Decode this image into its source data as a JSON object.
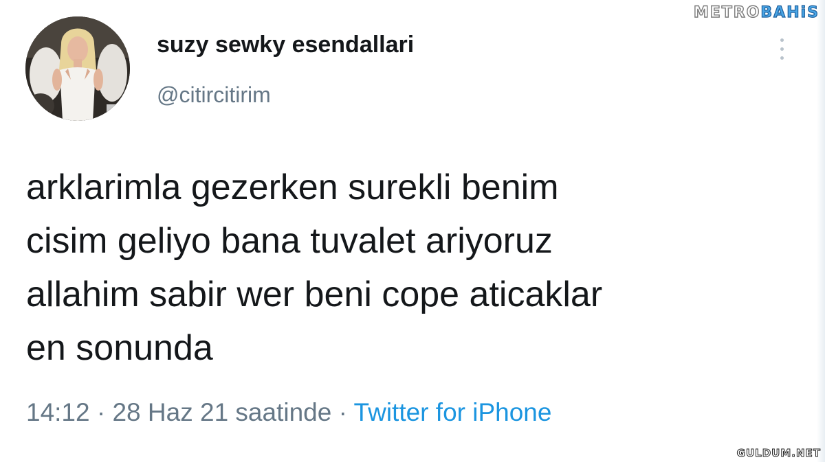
{
  "watermark": {
    "brand_part1": "METRO",
    "brand_part2": "BAHiS",
    "bottom_text": "GULDUM.NET"
  },
  "tweet": {
    "display_name": "suzy sewky esendallari",
    "handle": "@citircitirim",
    "text": "arklarimla gezerken surekli benim\ncisim geliyo bana tuvalet ariyoruz\nallahim sabir wer beni cope aticaklar\nen sonunda",
    "time": "14:12",
    "separator1": " · ",
    "date_text": "28 Haz 21 saatinde",
    "separator2": " · ",
    "source": "Twitter for iPhone"
  },
  "icons": {
    "more": "vertical-ellipsis-icon",
    "avatar": "profile-photo"
  },
  "colors": {
    "text_primary": "#14171a",
    "text_secondary": "#657786",
    "link": "#1b95e0",
    "watermark_blue": "#4aa6e6"
  }
}
